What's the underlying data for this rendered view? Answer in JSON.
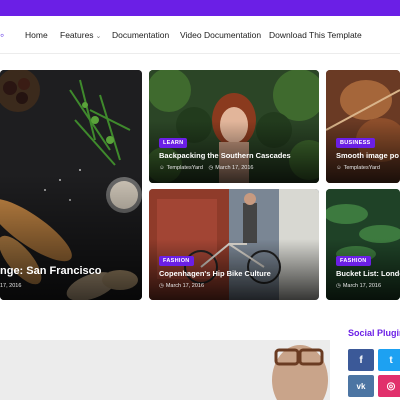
{
  "header": {
    "accent_color": "#6b1fe6",
    "nav": [
      {
        "label": "Home"
      },
      {
        "label": "Features",
        "has_dropdown": true
      },
      {
        "label": "Documentation"
      },
      {
        "label": "Video Documentation"
      },
      {
        "label": "Download This Template"
      }
    ]
  },
  "featured": [
    {
      "title": "nge: San Francisco",
      "date": "17, 2016"
    },
    {
      "category": "LEARN",
      "title": "Backpacking the Southern Cascades",
      "author": "TemplatesYard",
      "date": "March 17, 2016"
    },
    {
      "category": "BUSINESS",
      "title": "Smooth image po",
      "author": "TemplatesYard"
    },
    {
      "category": "FASHION",
      "title": "Copenhagen's Hip Bike Culture",
      "date": "March 17, 2016"
    },
    {
      "category": "FASHION",
      "title": "Bucket List: Londo",
      "date": "March 17, 2016"
    }
  ],
  "sidebar": {
    "title": "Social Plugin",
    "socials": [
      {
        "icon": "facebook-icon",
        "glyph": "f",
        "color": "#3b5998"
      },
      {
        "icon": "twitter-icon",
        "glyph": "t",
        "color": "#1da1f2"
      },
      {
        "icon": "vk-icon",
        "glyph": "vk",
        "color": "#4c75a3"
      },
      {
        "icon": "instagram-icon",
        "glyph": "◎",
        "color": "#e1306c"
      }
    ]
  }
}
